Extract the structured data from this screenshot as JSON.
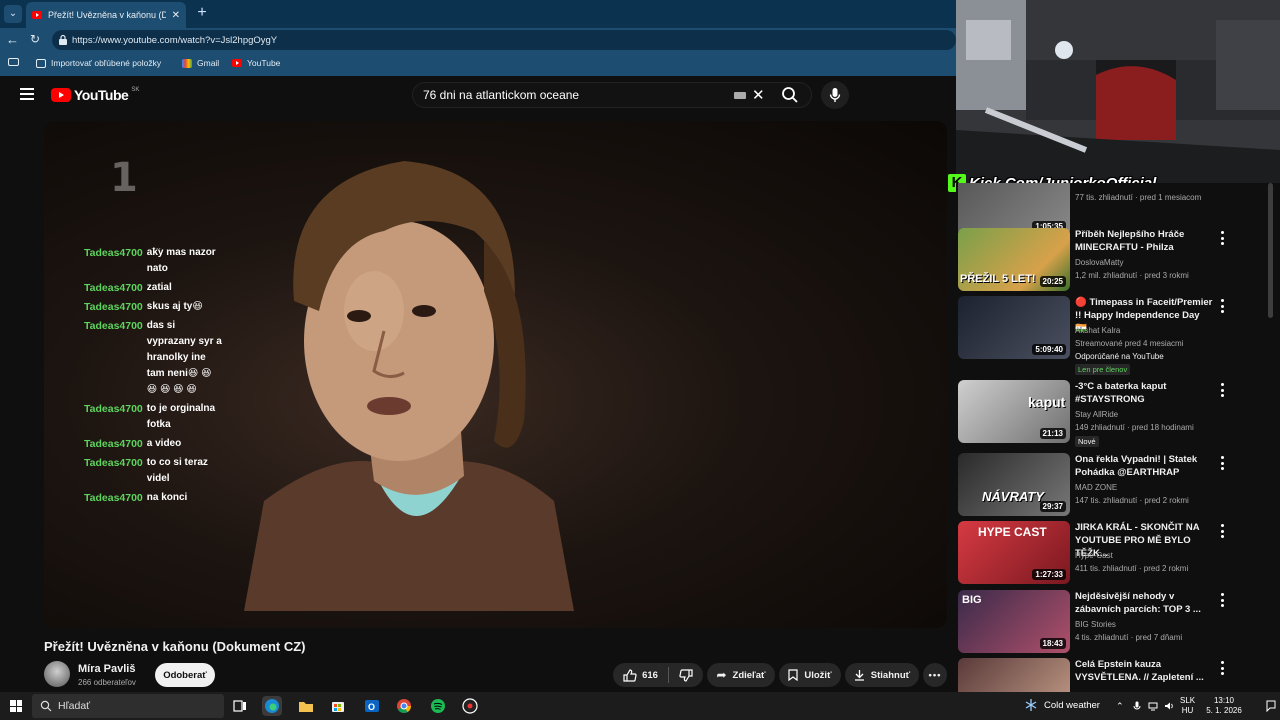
{
  "browser": {
    "tab_title": "Přežít! Uvězněna v kaňonu (Dokum",
    "url": "https://www.youtube.com/watch?v=Jsl2hpgOygY",
    "favorites": [
      {
        "label": "Importovať obľúbené položky"
      },
      {
        "label": "Gmail"
      },
      {
        "label": "YouTube"
      }
    ]
  },
  "youtube": {
    "logo_text": "YouTube",
    "country_code": "SK",
    "search_value": "76 dni na atlantickom oceane",
    "video": {
      "title": "Přežít! Uvězněna v kaňonu (Dokument CZ)",
      "channel_watermark": "1",
      "channel": "Míra Pavliš",
      "subscribers": "266 odberateľov",
      "subscribe_label": "Odoberať",
      "likes": "616",
      "share_label": "Zdieľať",
      "save_label": "Uložiť",
      "download_label": "Stiahnuť"
    },
    "chat": {
      "ellipsis": "....",
      "messages": [
        {
          "user": "Tadeas4700",
          "text": "aky mas nazor nato"
        },
        {
          "user": "Tadeas4700",
          "text": "zatial"
        },
        {
          "user": "Tadeas4700",
          "text": "skus aj ty😆"
        },
        {
          "user": "Tadeas4700",
          "text": "das si vyprazany syr a hranolky ine tam neni😆 😆 😆 😆 😆 😆"
        },
        {
          "user": "Tadeas4700",
          "text": "to je orginalna fotka"
        },
        {
          "user": "Tadeas4700",
          "text": "a video"
        },
        {
          "user": "Tadeas4700",
          "text": "to co si teraz videl"
        },
        {
          "user": "Tadeas4700",
          "text": "na konci"
        }
      ]
    }
  },
  "overlay": {
    "kick_text": "Kick.Com/JuniorkoOfficial"
  },
  "recommendations": [
    {
      "title": "",
      "channel": "",
      "meta": "77 tis. zhliadnutí · pred 1 mesiacom",
      "duration": "1:05:35",
      "color": "#6d6d6d"
    },
    {
      "title": "Příběh Nejlepšího Hráče MINECRAFTU - Philza",
      "channel": "DoslovaMatty",
      "meta": "1,2 mil. zhliadnutí · pred 3 rokmi",
      "duration": "20:25",
      "color": "#6a8b3c",
      "thumb_text": "PŘEŽIL 5 LET!"
    },
    {
      "title": "🔴 Timepass in Faceit/Premier !! Happy Independence Day 🇮🇳",
      "channel": "Akshat Kalra",
      "meta": "Streamované pred 4 mesiacmi",
      "extra": "Odporúčané na YouTube",
      "badge": "Len pre členov",
      "duration": "5:09:40",
      "color": "#2b2f3a"
    },
    {
      "title": "-3°C a baterka kaput #STAYSTRONG",
      "channel": "Stay AllRide",
      "meta": "149 zhliadnutí · pred 18 hodinami",
      "badge": "Nové",
      "duration": "21:13",
      "color": "#9a9a9a",
      "thumb_text": "kaput"
    },
    {
      "title": "Ona řekla Vypadni! | Statek Pohádka @EARTHRAP",
      "channel": "MAD ZONE",
      "meta": "147 tis. zhliadnutí · pred 2 rokmi",
      "duration": "29:37",
      "color": "#3b3b3b",
      "thumb_text": "NÁVRATY"
    },
    {
      "title": "JIRKA KRÁL - SKONČIT NA YOUTUBE PRO MĚ BYLO TĚŽK...",
      "channel": "Hype-Cast",
      "meta": "411 tis. zhliadnutí · pred 2 rokmi",
      "duration": "1:27:33",
      "color": "#c0303a",
      "thumb_text": "HYPE CAST"
    },
    {
      "title": "Nejděsivější nehody v zábavních parcích: TOP 3 ...",
      "channel": "BIG Stories",
      "meta": "4 tis. zhliadnutí · pred 7 dňami",
      "duration": "18:43",
      "color": "#4a3a5a",
      "thumb_text": "BIG"
    },
    {
      "title": "Celá Epstein kauza VYSVĚTLENA. // Zapletení ...",
      "channel": "",
      "meta": "",
      "duration": "",
      "color": "#6b4a4a"
    }
  ],
  "taskbar": {
    "search_placeholder": "Hľadať",
    "weather": "Cold weather",
    "lang_top": "SLK",
    "lang_bottom": "HU",
    "time": "13:10",
    "date": "5. 1. 2026"
  }
}
